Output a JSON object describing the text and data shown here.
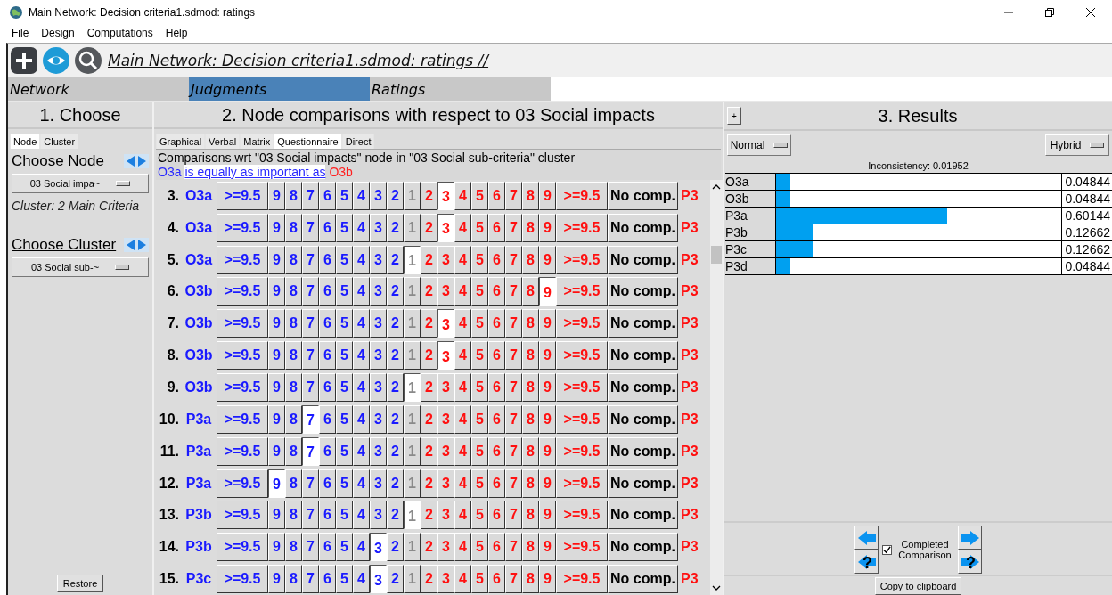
{
  "window": {
    "title": "Main Network: Decision criteria1.sdmod: ratings"
  },
  "menu": [
    "File",
    "Design",
    "Computations",
    "Help"
  ],
  "toolbar": {
    "title": "Main Network: Decision criteria1.sdmod: ratings //"
  },
  "mode_tabs": [
    {
      "label": "Network",
      "selected": false
    },
    {
      "label": "Judgments",
      "selected": true
    },
    {
      "label": "Ratings",
      "selected": false
    }
  ],
  "choose": {
    "heading": "1. Choose",
    "tabs": [
      {
        "label": "Node",
        "selected": true
      },
      {
        "label": "Cluster",
        "selected": false
      }
    ],
    "node_label": "Choose Node",
    "node_dropdown": "03 Social impa~",
    "cluster_info": "Cluster: 2 Main Criteria",
    "cluster_label": "Choose Cluster",
    "cluster_dropdown": "03 Social sub-~",
    "restore": "Restore"
  },
  "comparisons": {
    "heading": "2. Node comparisons with respect to 03 Social impacts",
    "tabs": [
      {
        "label": "Graphical",
        "selected": false
      },
      {
        "label": "Verbal",
        "selected": false
      },
      {
        "label": "Matrix",
        "selected": false
      },
      {
        "label": "Questionnaire",
        "selected": true
      },
      {
        "label": "Direct",
        "selected": false
      }
    ],
    "info": "Comparisons wrt \"03 Social impacts\" node in \"03 Social sub-criteria\" cluster",
    "verbal": {
      "left": "O3a",
      "phrase": "is equally as important as",
      "right": "O3b"
    },
    "rows": [
      {
        "number": "3.",
        "left": "O3a",
        "right": "P3",
        "cells": [
          {
            "label": ">=9.5",
            "kind": "left",
            "selected": false
          },
          {
            "label": "9",
            "kind": "left",
            "selected": false
          },
          {
            "label": "8",
            "kind": "left",
            "selected": false
          },
          {
            "label": "7",
            "kind": "left",
            "selected": false
          },
          {
            "label": "6",
            "kind": "left",
            "selected": false
          },
          {
            "label": "5",
            "kind": "left",
            "selected": false
          },
          {
            "label": "4",
            "kind": "left",
            "selected": false
          },
          {
            "label": "3",
            "kind": "left",
            "selected": false
          },
          {
            "label": "2",
            "kind": "left",
            "selected": false
          },
          {
            "label": "1",
            "kind": "equal",
            "selected": false
          },
          {
            "label": "2",
            "kind": "right",
            "selected": false
          },
          {
            "label": "3",
            "kind": "right",
            "selected": true
          },
          {
            "label": "4",
            "kind": "right",
            "selected": false
          },
          {
            "label": "5",
            "kind": "right",
            "selected": false
          },
          {
            "label": "6",
            "kind": "right",
            "selected": false
          },
          {
            "label": "7",
            "kind": "right",
            "selected": false
          },
          {
            "label": "8",
            "kind": "right",
            "selected": false
          },
          {
            "label": "9",
            "kind": "right",
            "selected": false
          },
          {
            "label": ">=9.5",
            "kind": "right",
            "selected": false
          },
          {
            "label": "No comp.",
            "kind": "none",
            "selected": false
          }
        ]
      },
      {
        "number": "4.",
        "left": "O3a",
        "right": "P3",
        "cells": [
          {
            "label": ">=9.5",
            "kind": "left",
            "selected": false
          },
          {
            "label": "9",
            "kind": "left",
            "selected": false
          },
          {
            "label": "8",
            "kind": "left",
            "selected": false
          },
          {
            "label": "7",
            "kind": "left",
            "selected": false
          },
          {
            "label": "6",
            "kind": "left",
            "selected": false
          },
          {
            "label": "5",
            "kind": "left",
            "selected": false
          },
          {
            "label": "4",
            "kind": "left",
            "selected": false
          },
          {
            "label": "3",
            "kind": "left",
            "selected": false
          },
          {
            "label": "2",
            "kind": "left",
            "selected": false
          },
          {
            "label": "1",
            "kind": "equal",
            "selected": false
          },
          {
            "label": "2",
            "kind": "right",
            "selected": false
          },
          {
            "label": "3",
            "kind": "right",
            "selected": true
          },
          {
            "label": "4",
            "kind": "right",
            "selected": false
          },
          {
            "label": "5",
            "kind": "right",
            "selected": false
          },
          {
            "label": "6",
            "kind": "right",
            "selected": false
          },
          {
            "label": "7",
            "kind": "right",
            "selected": false
          },
          {
            "label": "8",
            "kind": "right",
            "selected": false
          },
          {
            "label": "9",
            "kind": "right",
            "selected": false
          },
          {
            "label": ">=9.5",
            "kind": "right",
            "selected": false
          },
          {
            "label": "No comp.",
            "kind": "none",
            "selected": false
          }
        ]
      },
      {
        "number": "5.",
        "left": "O3a",
        "right": "P3",
        "cells": [
          {
            "label": ">=9.5",
            "kind": "left",
            "selected": false
          },
          {
            "label": "9",
            "kind": "left",
            "selected": false
          },
          {
            "label": "8",
            "kind": "left",
            "selected": false
          },
          {
            "label": "7",
            "kind": "left",
            "selected": false
          },
          {
            "label": "6",
            "kind": "left",
            "selected": false
          },
          {
            "label": "5",
            "kind": "left",
            "selected": false
          },
          {
            "label": "4",
            "kind": "left",
            "selected": false
          },
          {
            "label": "3",
            "kind": "left",
            "selected": false
          },
          {
            "label": "2",
            "kind": "left",
            "selected": false
          },
          {
            "label": "1",
            "kind": "equal",
            "selected": true
          },
          {
            "label": "2",
            "kind": "right",
            "selected": false
          },
          {
            "label": "3",
            "kind": "right",
            "selected": false
          },
          {
            "label": "4",
            "kind": "right",
            "selected": false
          },
          {
            "label": "5",
            "kind": "right",
            "selected": false
          },
          {
            "label": "6",
            "kind": "right",
            "selected": false
          },
          {
            "label": "7",
            "kind": "right",
            "selected": false
          },
          {
            "label": "8",
            "kind": "right",
            "selected": false
          },
          {
            "label": "9",
            "kind": "right",
            "selected": false
          },
          {
            "label": ">=9.5",
            "kind": "right",
            "selected": false
          },
          {
            "label": "No comp.",
            "kind": "none",
            "selected": false
          }
        ]
      },
      {
        "number": "6.",
        "left": "O3b",
        "right": "P3",
        "cells": [
          {
            "label": ">=9.5",
            "kind": "left",
            "selected": false
          },
          {
            "label": "9",
            "kind": "left",
            "selected": false
          },
          {
            "label": "8",
            "kind": "left",
            "selected": false
          },
          {
            "label": "7",
            "kind": "left",
            "selected": false
          },
          {
            "label": "6",
            "kind": "left",
            "selected": false
          },
          {
            "label": "5",
            "kind": "left",
            "selected": false
          },
          {
            "label": "4",
            "kind": "left",
            "selected": false
          },
          {
            "label": "3",
            "kind": "left",
            "selected": false
          },
          {
            "label": "2",
            "kind": "left",
            "selected": false
          },
          {
            "label": "1",
            "kind": "equal",
            "selected": false
          },
          {
            "label": "2",
            "kind": "right",
            "selected": false
          },
          {
            "label": "3",
            "kind": "right",
            "selected": false
          },
          {
            "label": "4",
            "kind": "right",
            "selected": false
          },
          {
            "label": "5",
            "kind": "right",
            "selected": false
          },
          {
            "label": "6",
            "kind": "right",
            "selected": false
          },
          {
            "label": "7",
            "kind": "right",
            "selected": false
          },
          {
            "label": "8",
            "kind": "right",
            "selected": false
          },
          {
            "label": "9",
            "kind": "right",
            "selected": true
          },
          {
            "label": ">=9.5",
            "kind": "right",
            "selected": false
          },
          {
            "label": "No comp.",
            "kind": "none",
            "selected": false
          }
        ]
      },
      {
        "number": "7.",
        "left": "O3b",
        "right": "P3",
        "cells": [
          {
            "label": ">=9.5",
            "kind": "left",
            "selected": false
          },
          {
            "label": "9",
            "kind": "left",
            "selected": false
          },
          {
            "label": "8",
            "kind": "left",
            "selected": false
          },
          {
            "label": "7",
            "kind": "left",
            "selected": false
          },
          {
            "label": "6",
            "kind": "left",
            "selected": false
          },
          {
            "label": "5",
            "kind": "left",
            "selected": false
          },
          {
            "label": "4",
            "kind": "left",
            "selected": false
          },
          {
            "label": "3",
            "kind": "left",
            "selected": false
          },
          {
            "label": "2",
            "kind": "left",
            "selected": false
          },
          {
            "label": "1",
            "kind": "equal",
            "selected": false
          },
          {
            "label": "2",
            "kind": "right",
            "selected": false
          },
          {
            "label": "3",
            "kind": "right",
            "selected": true
          },
          {
            "label": "4",
            "kind": "right",
            "selected": false
          },
          {
            "label": "5",
            "kind": "right",
            "selected": false
          },
          {
            "label": "6",
            "kind": "right",
            "selected": false
          },
          {
            "label": "7",
            "kind": "right",
            "selected": false
          },
          {
            "label": "8",
            "kind": "right",
            "selected": false
          },
          {
            "label": "9",
            "kind": "right",
            "selected": false
          },
          {
            "label": ">=9.5",
            "kind": "right",
            "selected": false
          },
          {
            "label": "No comp.",
            "kind": "none",
            "selected": false
          }
        ]
      },
      {
        "number": "8.",
        "left": "O3b",
        "right": "P3",
        "cells": [
          {
            "label": ">=9.5",
            "kind": "left",
            "selected": false
          },
          {
            "label": "9",
            "kind": "left",
            "selected": false
          },
          {
            "label": "8",
            "kind": "left",
            "selected": false
          },
          {
            "label": "7",
            "kind": "left",
            "selected": false
          },
          {
            "label": "6",
            "kind": "left",
            "selected": false
          },
          {
            "label": "5",
            "kind": "left",
            "selected": false
          },
          {
            "label": "4",
            "kind": "left",
            "selected": false
          },
          {
            "label": "3",
            "kind": "left",
            "selected": false
          },
          {
            "label": "2",
            "kind": "left",
            "selected": false
          },
          {
            "label": "1",
            "kind": "equal",
            "selected": false
          },
          {
            "label": "2",
            "kind": "right",
            "selected": false
          },
          {
            "label": "3",
            "kind": "right",
            "selected": true
          },
          {
            "label": "4",
            "kind": "right",
            "selected": false
          },
          {
            "label": "5",
            "kind": "right",
            "selected": false
          },
          {
            "label": "6",
            "kind": "right",
            "selected": false
          },
          {
            "label": "7",
            "kind": "right",
            "selected": false
          },
          {
            "label": "8",
            "kind": "right",
            "selected": false
          },
          {
            "label": "9",
            "kind": "right",
            "selected": false
          },
          {
            "label": ">=9.5",
            "kind": "right",
            "selected": false
          },
          {
            "label": "No comp.",
            "kind": "none",
            "selected": false
          }
        ]
      },
      {
        "number": "9.",
        "left": "O3b",
        "right": "P3",
        "cells": [
          {
            "label": ">=9.5",
            "kind": "left",
            "selected": false
          },
          {
            "label": "9",
            "kind": "left",
            "selected": false
          },
          {
            "label": "8",
            "kind": "left",
            "selected": false
          },
          {
            "label": "7",
            "kind": "left",
            "selected": false
          },
          {
            "label": "6",
            "kind": "left",
            "selected": false
          },
          {
            "label": "5",
            "kind": "left",
            "selected": false
          },
          {
            "label": "4",
            "kind": "left",
            "selected": false
          },
          {
            "label": "3",
            "kind": "left",
            "selected": false
          },
          {
            "label": "2",
            "kind": "left",
            "selected": false
          },
          {
            "label": "1",
            "kind": "equal",
            "selected": true
          },
          {
            "label": "2",
            "kind": "right",
            "selected": false
          },
          {
            "label": "3",
            "kind": "right",
            "selected": false
          },
          {
            "label": "4",
            "kind": "right",
            "selected": false
          },
          {
            "label": "5",
            "kind": "right",
            "selected": false
          },
          {
            "label": "6",
            "kind": "right",
            "selected": false
          },
          {
            "label": "7",
            "kind": "right",
            "selected": false
          },
          {
            "label": "8",
            "kind": "right",
            "selected": false
          },
          {
            "label": "9",
            "kind": "right",
            "selected": false
          },
          {
            "label": ">=9.5",
            "kind": "right",
            "selected": false
          },
          {
            "label": "No comp.",
            "kind": "none",
            "selected": false
          }
        ]
      },
      {
        "number": "10.",
        "left": "P3a",
        "right": "P3",
        "cells": [
          {
            "label": ">=9.5",
            "kind": "left",
            "selected": false
          },
          {
            "label": "9",
            "kind": "left",
            "selected": false
          },
          {
            "label": "8",
            "kind": "left",
            "selected": false
          },
          {
            "label": "7",
            "kind": "left",
            "selected": true
          },
          {
            "label": "6",
            "kind": "left",
            "selected": false
          },
          {
            "label": "5",
            "kind": "left",
            "selected": false
          },
          {
            "label": "4",
            "kind": "left",
            "selected": false
          },
          {
            "label": "3",
            "kind": "left",
            "selected": false
          },
          {
            "label": "2",
            "kind": "left",
            "selected": false
          },
          {
            "label": "1",
            "kind": "equal",
            "selected": false
          },
          {
            "label": "2",
            "kind": "right",
            "selected": false
          },
          {
            "label": "3",
            "kind": "right",
            "selected": false
          },
          {
            "label": "4",
            "kind": "right",
            "selected": false
          },
          {
            "label": "5",
            "kind": "right",
            "selected": false
          },
          {
            "label": "6",
            "kind": "right",
            "selected": false
          },
          {
            "label": "7",
            "kind": "right",
            "selected": false
          },
          {
            "label": "8",
            "kind": "right",
            "selected": false
          },
          {
            "label": "9",
            "kind": "right",
            "selected": false
          },
          {
            "label": ">=9.5",
            "kind": "right",
            "selected": false
          },
          {
            "label": "No comp.",
            "kind": "none",
            "selected": false
          }
        ]
      },
      {
        "number": "11.",
        "left": "P3a",
        "right": "P3",
        "cells": [
          {
            "label": ">=9.5",
            "kind": "left",
            "selected": false
          },
          {
            "label": "9",
            "kind": "left",
            "selected": false
          },
          {
            "label": "8",
            "kind": "left",
            "selected": false
          },
          {
            "label": "7",
            "kind": "left",
            "selected": true
          },
          {
            "label": "6",
            "kind": "left",
            "selected": false
          },
          {
            "label": "5",
            "kind": "left",
            "selected": false
          },
          {
            "label": "4",
            "kind": "left",
            "selected": false
          },
          {
            "label": "3",
            "kind": "left",
            "selected": false
          },
          {
            "label": "2",
            "kind": "left",
            "selected": false
          },
          {
            "label": "1",
            "kind": "equal",
            "selected": false
          },
          {
            "label": "2",
            "kind": "right",
            "selected": false
          },
          {
            "label": "3",
            "kind": "right",
            "selected": false
          },
          {
            "label": "4",
            "kind": "right",
            "selected": false
          },
          {
            "label": "5",
            "kind": "right",
            "selected": false
          },
          {
            "label": "6",
            "kind": "right",
            "selected": false
          },
          {
            "label": "7",
            "kind": "right",
            "selected": false
          },
          {
            "label": "8",
            "kind": "right",
            "selected": false
          },
          {
            "label": "9",
            "kind": "right",
            "selected": false
          },
          {
            "label": ">=9.5",
            "kind": "right",
            "selected": false
          },
          {
            "label": "No comp.",
            "kind": "none",
            "selected": false
          }
        ]
      },
      {
        "number": "12.",
        "left": "P3a",
        "right": "P3",
        "cells": [
          {
            "label": ">=9.5",
            "kind": "left",
            "selected": false
          },
          {
            "label": "9",
            "kind": "left",
            "selected": true
          },
          {
            "label": "8",
            "kind": "left",
            "selected": false
          },
          {
            "label": "7",
            "kind": "left",
            "selected": false
          },
          {
            "label": "6",
            "kind": "left",
            "selected": false
          },
          {
            "label": "5",
            "kind": "left",
            "selected": false
          },
          {
            "label": "4",
            "kind": "left",
            "selected": false
          },
          {
            "label": "3",
            "kind": "left",
            "selected": false
          },
          {
            "label": "2",
            "kind": "left",
            "selected": false
          },
          {
            "label": "1",
            "kind": "equal",
            "selected": false
          },
          {
            "label": "2",
            "kind": "right",
            "selected": false
          },
          {
            "label": "3",
            "kind": "right",
            "selected": false
          },
          {
            "label": "4",
            "kind": "right",
            "selected": false
          },
          {
            "label": "5",
            "kind": "right",
            "selected": false
          },
          {
            "label": "6",
            "kind": "right",
            "selected": false
          },
          {
            "label": "7",
            "kind": "right",
            "selected": false
          },
          {
            "label": "8",
            "kind": "right",
            "selected": false
          },
          {
            "label": "9",
            "kind": "right",
            "selected": false
          },
          {
            "label": ">=9.5",
            "kind": "right",
            "selected": false
          },
          {
            "label": "No comp.",
            "kind": "none",
            "selected": false
          }
        ]
      },
      {
        "number": "13.",
        "left": "P3b",
        "right": "P3",
        "cells": [
          {
            "label": ">=9.5",
            "kind": "left",
            "selected": false
          },
          {
            "label": "9",
            "kind": "left",
            "selected": false
          },
          {
            "label": "8",
            "kind": "left",
            "selected": false
          },
          {
            "label": "7",
            "kind": "left",
            "selected": false
          },
          {
            "label": "6",
            "kind": "left",
            "selected": false
          },
          {
            "label": "5",
            "kind": "left",
            "selected": false
          },
          {
            "label": "4",
            "kind": "left",
            "selected": false
          },
          {
            "label": "3",
            "kind": "left",
            "selected": false
          },
          {
            "label": "2",
            "kind": "left",
            "selected": false
          },
          {
            "label": "1",
            "kind": "equal",
            "selected": true
          },
          {
            "label": "2",
            "kind": "right",
            "selected": false
          },
          {
            "label": "3",
            "kind": "right",
            "selected": false
          },
          {
            "label": "4",
            "kind": "right",
            "selected": false
          },
          {
            "label": "5",
            "kind": "right",
            "selected": false
          },
          {
            "label": "6",
            "kind": "right",
            "selected": false
          },
          {
            "label": "7",
            "kind": "right",
            "selected": false
          },
          {
            "label": "8",
            "kind": "right",
            "selected": false
          },
          {
            "label": "9",
            "kind": "right",
            "selected": false
          },
          {
            "label": ">=9.5",
            "kind": "right",
            "selected": false
          },
          {
            "label": "No comp.",
            "kind": "none",
            "selected": false
          }
        ]
      },
      {
        "number": "14.",
        "left": "P3b",
        "right": "P3",
        "cells": [
          {
            "label": ">=9.5",
            "kind": "left",
            "selected": false
          },
          {
            "label": "9",
            "kind": "left",
            "selected": false
          },
          {
            "label": "8",
            "kind": "left",
            "selected": false
          },
          {
            "label": "7",
            "kind": "left",
            "selected": false
          },
          {
            "label": "6",
            "kind": "left",
            "selected": false
          },
          {
            "label": "5",
            "kind": "left",
            "selected": false
          },
          {
            "label": "4",
            "kind": "left",
            "selected": false
          },
          {
            "label": "3",
            "kind": "left",
            "selected": true
          },
          {
            "label": "2",
            "kind": "left",
            "selected": false
          },
          {
            "label": "1",
            "kind": "equal",
            "selected": false
          },
          {
            "label": "2",
            "kind": "right",
            "selected": false
          },
          {
            "label": "3",
            "kind": "right",
            "selected": false
          },
          {
            "label": "4",
            "kind": "right",
            "selected": false
          },
          {
            "label": "5",
            "kind": "right",
            "selected": false
          },
          {
            "label": "6",
            "kind": "right",
            "selected": false
          },
          {
            "label": "7",
            "kind": "right",
            "selected": false
          },
          {
            "label": "8",
            "kind": "right",
            "selected": false
          },
          {
            "label": "9",
            "kind": "right",
            "selected": false
          },
          {
            "label": ">=9.5",
            "kind": "right",
            "selected": false
          },
          {
            "label": "No comp.",
            "kind": "none",
            "selected": false
          }
        ]
      },
      {
        "number": "15.",
        "left": "P3c",
        "right": "P3",
        "cells": [
          {
            "label": ">=9.5",
            "kind": "left",
            "selected": false
          },
          {
            "label": "9",
            "kind": "left",
            "selected": false
          },
          {
            "label": "8",
            "kind": "left",
            "selected": false
          },
          {
            "label": "7",
            "kind": "left",
            "selected": false
          },
          {
            "label": "6",
            "kind": "left",
            "selected": false
          },
          {
            "label": "5",
            "kind": "left",
            "selected": false
          },
          {
            "label": "4",
            "kind": "left",
            "selected": false
          },
          {
            "label": "3",
            "kind": "left",
            "selected": true
          },
          {
            "label": "2",
            "kind": "left",
            "selected": false
          },
          {
            "label": "1",
            "kind": "equal",
            "selected": false
          },
          {
            "label": "2",
            "kind": "right",
            "selected": false
          },
          {
            "label": "3",
            "kind": "right",
            "selected": false
          },
          {
            "label": "4",
            "kind": "right",
            "selected": false
          },
          {
            "label": "5",
            "kind": "right",
            "selected": false
          },
          {
            "label": "6",
            "kind": "right",
            "selected": false
          },
          {
            "label": "7",
            "kind": "right",
            "selected": false
          },
          {
            "label": "8",
            "kind": "right",
            "selected": false
          },
          {
            "label": "9",
            "kind": "right",
            "selected": false
          },
          {
            "label": ">=9.5",
            "kind": "right",
            "selected": false
          },
          {
            "label": "No comp.",
            "kind": "none",
            "selected": false
          }
        ]
      }
    ]
  },
  "results": {
    "expand": "+",
    "heading": "3. Results",
    "mode": "Normal",
    "method": "Hybrid",
    "inconsistency": "Inconsistency: 0.01952",
    "rows": [
      {
        "name": "O3a",
        "level": 0.04844,
        "value": "0.04844"
      },
      {
        "name": "O3b",
        "level": 0.04844,
        "value": "0.04844"
      },
      {
        "name": "P3a",
        "level": 0.60144,
        "value": "0.60144"
      },
      {
        "name": "P3b",
        "level": 0.12662,
        "value": "0.12662"
      },
      {
        "name": "P3c",
        "level": 0.12662,
        "value": "0.12662"
      },
      {
        "name": "P3d",
        "level": 0.04844,
        "value": "0.04844"
      }
    ],
    "previous_unfinished_mark": "?",
    "next_unfinished_mark": "?",
    "completed": {
      "label": "Completed Comparison",
      "checked": true
    },
    "copy": "Copy to clipboard"
  }
}
